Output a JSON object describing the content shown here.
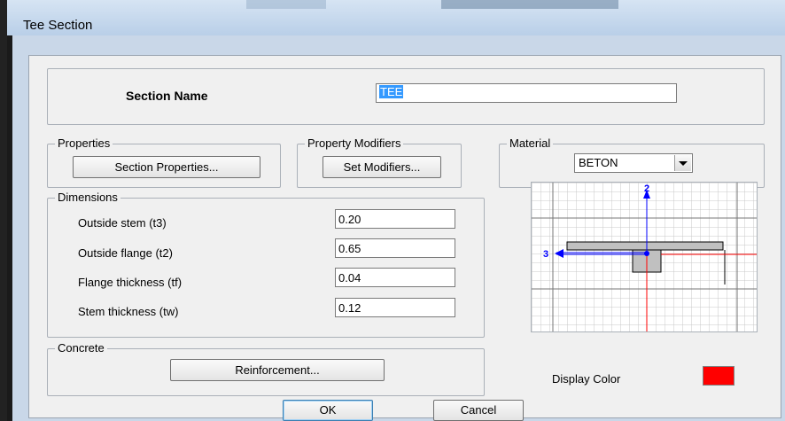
{
  "window": {
    "title": "Tee Section"
  },
  "section_name": {
    "label": "Section Name",
    "value": "TEE"
  },
  "properties": {
    "legend": "Properties",
    "button": "Section Properties..."
  },
  "property_modifiers": {
    "legend": "Property Modifiers",
    "button": "Set Modifiers..."
  },
  "material": {
    "legend": "Material",
    "selected": "BETON",
    "dropdown_icon": "chevron-down-icon"
  },
  "dimensions": {
    "legend": "Dimensions",
    "fields": [
      {
        "label": "Outside stem  (t3)",
        "value": "0.20"
      },
      {
        "label": "Outside flange  (t2)",
        "value": "0.65"
      },
      {
        "label": "Flange thickness  (tf)",
        "value": "0.04"
      },
      {
        "label": "Stem thickness  (tw)",
        "value": "0.12"
      }
    ]
  },
  "preview": {
    "axis_vertical": "2",
    "axis_horizontal": "3"
  },
  "concrete": {
    "legend": "Concrete",
    "button": "Reinforcement..."
  },
  "display_color": {
    "label": "Display Color",
    "color": "#ff0000"
  },
  "footer": {
    "ok": "OK",
    "cancel": "Cancel"
  }
}
